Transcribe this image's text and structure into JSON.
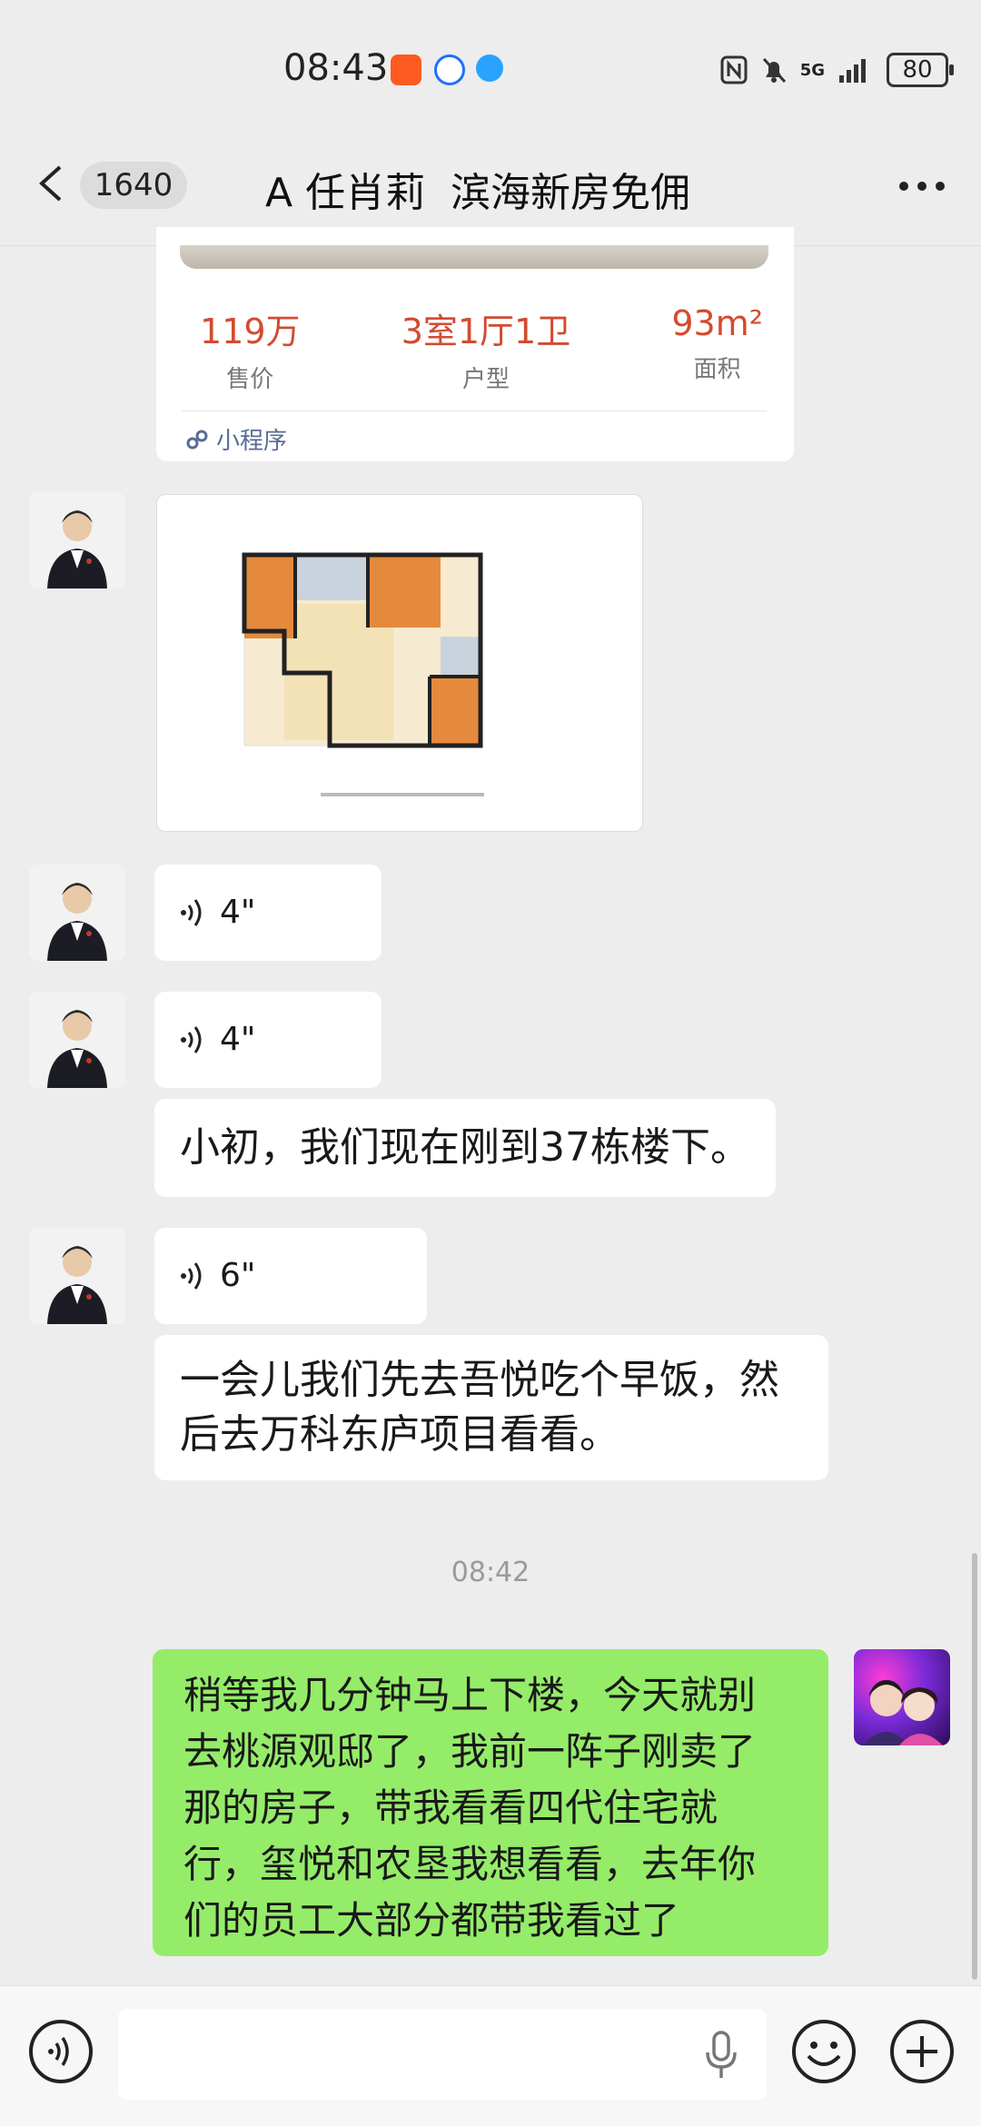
{
  "status_bar": {
    "time": "08:43",
    "network": "5G",
    "battery": "80",
    "app_icons": [
      "taobao-icon",
      "blue-circle-app-icon",
      "blue-dot-app-icon"
    ]
  },
  "header": {
    "unread_count": "1640",
    "chat_title": "A 任肖莉  滨海新房免佣"
  },
  "mini_program_card": {
    "stats": [
      {
        "value": "119万",
        "label": "售价"
      },
      {
        "value": "3室1厅1卫",
        "label": "户型"
      },
      {
        "value": "93m²",
        "label": "面积"
      }
    ],
    "footer_label": "小程序"
  },
  "messages": {
    "voice_1": "4\"",
    "voice_2": "4\"",
    "text_1": "小初，我们现在刚到37栋楼下。",
    "voice_3": "6\"",
    "text_2_line1": "一会儿我们先去吾悦吃个早饭，然",
    "text_2_line2": "后去万科东庐项目看看。",
    "timestamp": "08:42",
    "my_message_lines": [
      "稍等我几分钟马上下楼，今天就别",
      "去桃源观邸了，我前一阵子刚卖了",
      "那的房子，带我看看四代住宅就",
      "行，玺悦和农垦我想看看，去年你",
      "们的员工大部分都带我看过了"
    ]
  },
  "colors": {
    "chat_background": "#ededed",
    "my_bubble": "#95ec69",
    "price_accent": "#d24b30",
    "link_blue": "#576b95"
  }
}
